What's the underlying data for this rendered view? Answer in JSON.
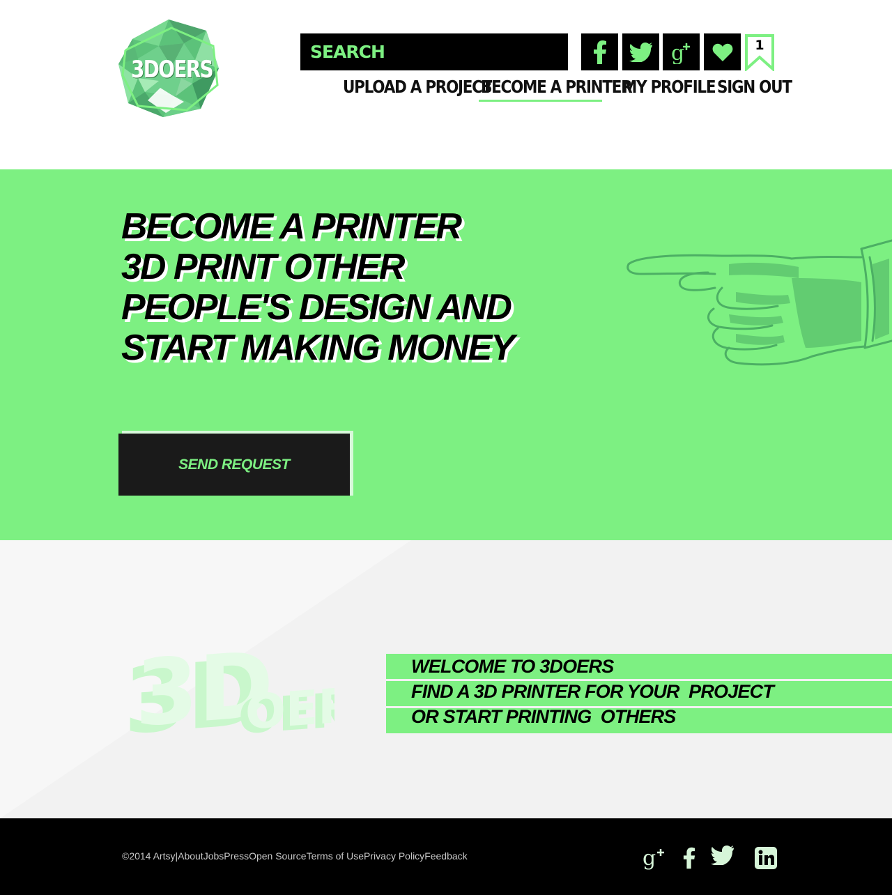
{
  "header": {
    "logo_text": "3DOERS",
    "search": {
      "placeholder": "SEARCH",
      "value": ""
    },
    "social": [
      {
        "icon": "facebook-icon"
      },
      {
        "icon": "twitter-icon"
      },
      {
        "icon": "google-plus-icon"
      },
      {
        "icon": "heart-icon"
      }
    ],
    "bookmark_count": "1",
    "nav": {
      "upload": "UPLOAD A PROJECT",
      "become_printer": "BECOME A PRINTER",
      "profile": "MY PROFILE",
      "sign_out": "SIGN OUT",
      "active": "BECOME A PRINTER"
    }
  },
  "hero": {
    "lines": [
      "BECOME A PRINTER",
      "3D PRINT OTHER",
      "PEOPLE'S DESIGN AND",
      "START MAKING MONEY"
    ],
    "button_label": "SEND REQUEST"
  },
  "welcome": {
    "logo_3d": "3D",
    "logo_oers": "OERS",
    "lines": [
      "WELCOME TO 3DOERS",
      "FIND A 3D PRINTER FOR YOUR  PROJECT",
      "OR START PRINTING  OTHERS"
    ]
  },
  "footer": {
    "copyright": "©2014 Artsy",
    "separator": "|",
    "links": [
      "About",
      "Jobs",
      "Press",
      "Open Source",
      "Terms of Use",
      "Privacy Policy",
      "Feedback"
    ],
    "icons": [
      "google-plus-icon",
      "facebook-icon",
      "twitter-icon",
      "linkedin-icon"
    ]
  },
  "colors": {
    "accent": "#7df082",
    "dark": "#000000",
    "hand": "#4caf64",
    "welcome_bg": "#f2f2f2"
  }
}
